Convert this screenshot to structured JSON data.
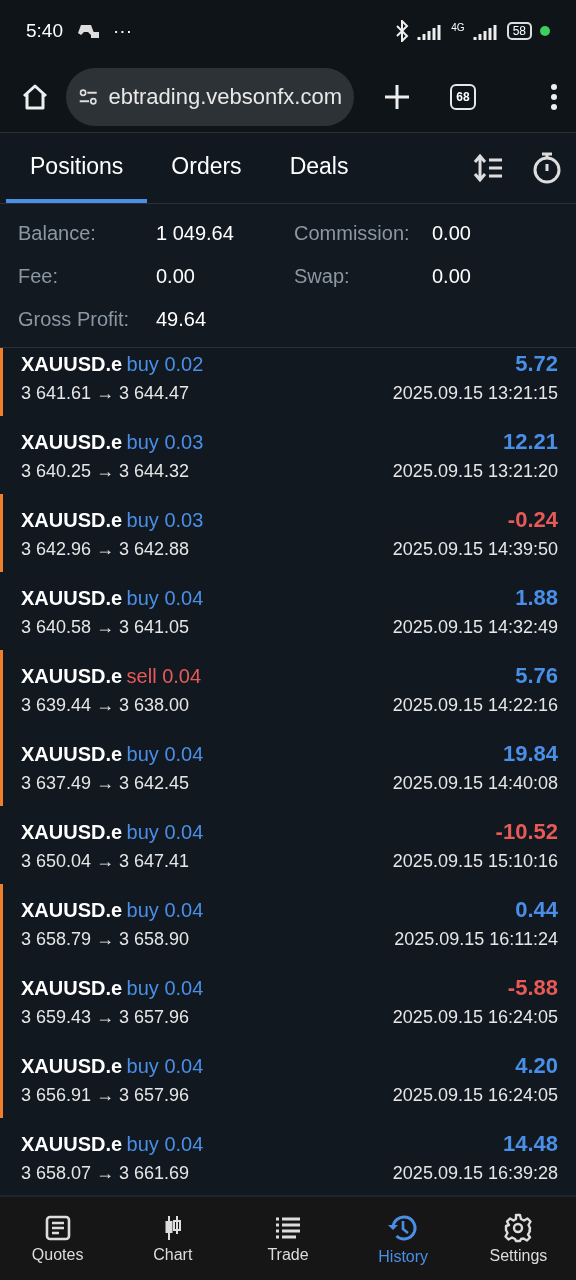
{
  "status_bar": {
    "time": "5:40",
    "more": "···",
    "network": "4G",
    "battery": "58"
  },
  "browser": {
    "url": "ebtrading.vebsonfx.com",
    "tab_count": "68"
  },
  "tabs": [
    {
      "label": "Positions",
      "selected": true
    },
    {
      "label": "Orders",
      "selected": false
    },
    {
      "label": "Deals",
      "selected": false
    }
  ],
  "summary": [
    {
      "label": "Balance:",
      "value": "1 049.64"
    },
    {
      "label": "Commission:",
      "value": "0.00"
    },
    {
      "label": "Fee:",
      "value": "0.00"
    },
    {
      "label": "Swap:",
      "value": "0.00"
    },
    {
      "label": "Gross Profit:",
      "value": "49.64"
    }
  ],
  "positions": [
    {
      "symbol": "XAUUSD.e",
      "side": "buy",
      "volume": "0.02",
      "prices": "3 641.61 → 3 644.47",
      "profit": "5.72",
      "profit_positive": true,
      "time": "2025.09.15 13:21:15",
      "marked": true
    },
    {
      "symbol": "XAUUSD.e",
      "side": "buy",
      "volume": "0.03",
      "prices": "3 640.25 → 3 644.32",
      "profit": "12.21",
      "profit_positive": true,
      "time": "2025.09.15 13:21:20",
      "marked": false
    },
    {
      "symbol": "XAUUSD.e",
      "side": "buy",
      "volume": "0.03",
      "prices": "3 642.96 → 3 642.88",
      "profit": "-0.24",
      "profit_positive": false,
      "time": "2025.09.15 14:39:50",
      "marked": true
    },
    {
      "symbol": "XAUUSD.e",
      "side": "buy",
      "volume": "0.04",
      "prices": "3 640.58 → 3 641.05",
      "profit": "1.88",
      "profit_positive": true,
      "time": "2025.09.15 14:32:49",
      "marked": false
    },
    {
      "symbol": "XAUUSD.e",
      "side": "sell",
      "volume": "0.04",
      "prices": "3 639.44 → 3 638.00",
      "profit": "5.76",
      "profit_positive": true,
      "time": "2025.09.15 14:22:16",
      "marked": true
    },
    {
      "symbol": "XAUUSD.e",
      "side": "buy",
      "volume": "0.04",
      "prices": "3 637.49 → 3 642.45",
      "profit": "19.84",
      "profit_positive": true,
      "time": "2025.09.15 14:40:08",
      "marked": true
    },
    {
      "symbol": "XAUUSD.e",
      "side": "buy",
      "volume": "0.04",
      "prices": "3 650.04 → 3 647.41",
      "profit": "-10.52",
      "profit_positive": false,
      "time": "2025.09.15 15:10:16",
      "marked": false
    },
    {
      "symbol": "XAUUSD.e",
      "side": "buy",
      "volume": "0.04",
      "prices": "3 658.79 → 3 658.90",
      "profit": "0.44",
      "profit_positive": true,
      "time": "2025.09.15 16:11:24",
      "marked": true
    },
    {
      "symbol": "XAUUSD.e",
      "side": "buy",
      "volume": "0.04",
      "prices": "3 659.43 → 3 657.96",
      "profit": "-5.88",
      "profit_positive": false,
      "time": "2025.09.15 16:24:05",
      "marked": true
    },
    {
      "symbol": "XAUUSD.e",
      "side": "buy",
      "volume": "0.04",
      "prices": "3 656.91 → 3 657.96",
      "profit": "4.20",
      "profit_positive": true,
      "time": "2025.09.15 16:24:05",
      "marked": true
    },
    {
      "symbol": "XAUUSD.e",
      "side": "buy",
      "volume": "0.04",
      "prices": "3 658.07 → 3 661.69",
      "profit": "14.48",
      "profit_positive": true,
      "time": "2025.09.15 16:39:28",
      "marked": false
    }
  ],
  "nav": [
    {
      "label": "Quotes",
      "kind": "quotes",
      "selected": false
    },
    {
      "label": "Chart",
      "kind": "chart",
      "selected": false
    },
    {
      "label": "Trade",
      "kind": "trade",
      "selected": false
    },
    {
      "label": "History",
      "kind": "history",
      "selected": true
    },
    {
      "label": "Settings",
      "kind": "settings",
      "selected": false
    }
  ]
}
